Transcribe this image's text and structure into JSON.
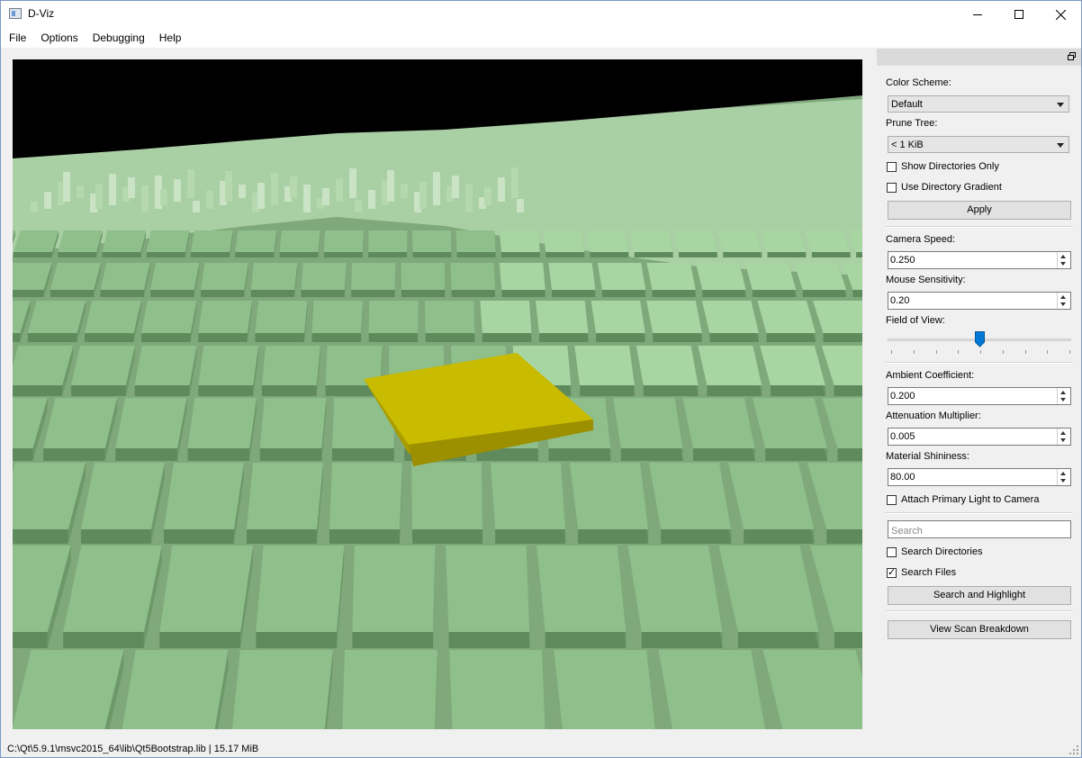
{
  "window": {
    "title": "D-Viz"
  },
  "menu": [
    "File",
    "Options",
    "Debugging",
    "Help"
  ],
  "panel": {
    "color_scheme_label": "Color Scheme:",
    "color_scheme_value": "Default",
    "prune_tree_label": "Prune Tree:",
    "prune_tree_value": "< 1 KiB",
    "show_dirs_only_label": "Show Directories Only",
    "use_dir_gradient_label": "Use Directory Gradient",
    "apply_label": "Apply",
    "camera_speed_label": "Camera Speed:",
    "camera_speed_value": "0.250",
    "mouse_sensitivity_label": "Mouse Sensitivity:",
    "mouse_sensitivity_value": "0.20",
    "fov_label": "Field of View:",
    "fov_fraction": 0.5,
    "ambient_label": "Ambient Coefficient:",
    "ambient_value": "0.200",
    "attenuation_label": "Attenuation Multiplier:",
    "attenuation_value": "0.005",
    "shininess_label": "Material Shininess:",
    "shininess_value": "80.00",
    "attach_light_label": "Attach Primary Light to Camera",
    "search_placeholder": "Search",
    "search_dirs_label": "Search Directories",
    "search_files_label": "Search Files",
    "search_files_checked": true,
    "search_highlight_label": "Search and Highlight",
    "view_breakdown_label": "View Scan Breakdown"
  },
  "status": {
    "text": "C:\\Qt\\5.9.1\\msvc2015_64\\lib\\Qt5Bootstrap.lib  |  15.17 MiB"
  },
  "colors": {
    "block_top": "#8fbf8a",
    "block_side": "#5f8a5c",
    "highlight": "#c8bb00",
    "sky": "#000000"
  }
}
